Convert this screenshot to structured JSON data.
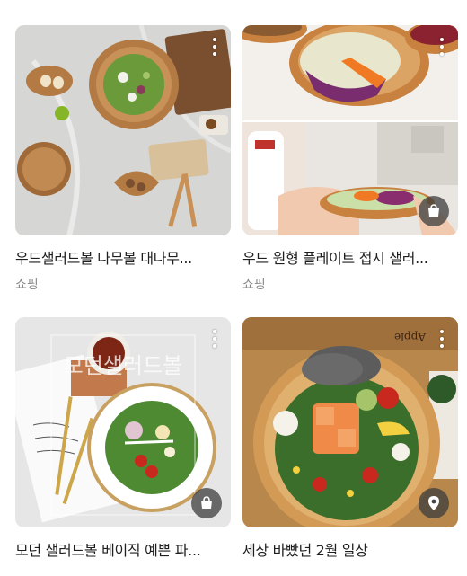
{
  "results": [
    {
      "title": "우드샐러드볼 나무볼 대나무...",
      "source": "쇼핑",
      "action_icon": "shopping-bag-icon"
    },
    {
      "title": "우드 원형 플레이트 접시 샐러...",
      "source": "쇼핑",
      "action_icon": "shopping-bag-icon"
    },
    {
      "title": "모던 샐러드볼 베이직 예쁜 파...",
      "source": "",
      "action_icon": "shopping-bag-icon",
      "image_overlay_text": "모던샐러드볼"
    },
    {
      "title": "세상 바빴던 2월 일상",
      "source": "",
      "action_icon": "location-pin-icon",
      "image_overlay_text": "Apple"
    }
  ]
}
